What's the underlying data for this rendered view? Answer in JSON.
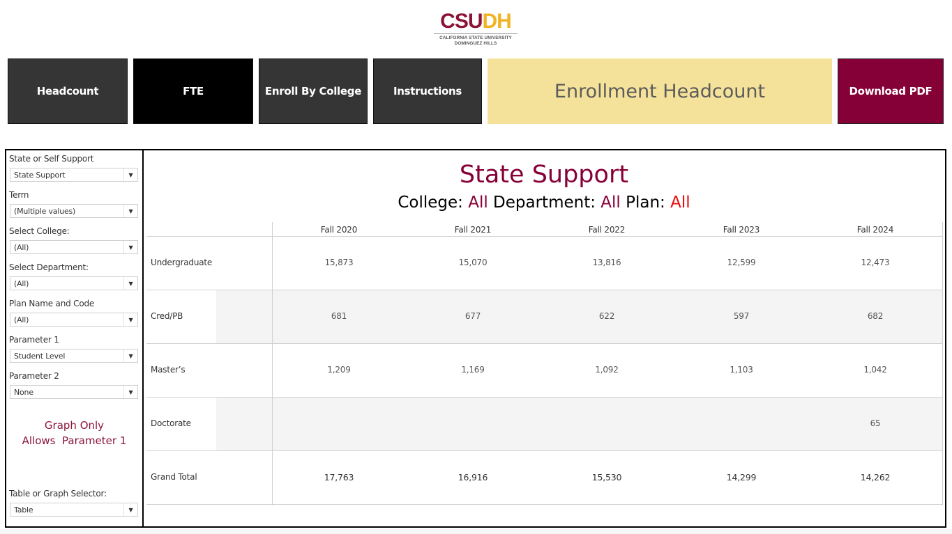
{
  "logo": {
    "word_csu": "CSU",
    "word_dh": "DH",
    "line1": "CALIFORNIA STATE UNIVERSITY",
    "line2": "DOMINGUEZ HILLS"
  },
  "nav": {
    "headcount": "Headcount",
    "fte": "FTE",
    "enroll_by_college": "Enroll By College",
    "instructions": "Instructions",
    "banner": "Enrollment Headcount",
    "download_pdf": "Download PDF"
  },
  "colors": {
    "maroon": "#860038",
    "gold": "#f0b323",
    "banner_bg": "#f5e29a",
    "red": "#e8090c",
    "dark_button": "#353535"
  },
  "filters": [
    {
      "label": "State or Self Support",
      "value": "State Support"
    },
    {
      "label": "Term",
      "value": "(Multiple values)"
    },
    {
      "label": "Select College:",
      "value": "(All)"
    },
    {
      "label": "Select Department:",
      "value": "(All)"
    },
    {
      "label": "Plan Name and Code",
      "value": "(All)"
    },
    {
      "label": "Parameter 1",
      "value": "Student Level"
    },
    {
      "label": "Parameter 2",
      "value": "None"
    }
  ],
  "note": {
    "line1": "Graph Only",
    "line2": "Allows  Parameter 1"
  },
  "view_selector": {
    "label": "Table or Graph Selector:",
    "value": "Table"
  },
  "dropdown_arrow_icon": "▼",
  "main": {
    "title": "State Support",
    "subtitle": {
      "college_label": "College: ",
      "college_value": "All",
      "department_label": " Department: ",
      "department_value": "All",
      "plan_label": " Plan: ",
      "plan_value": "All"
    }
  },
  "table": {
    "columns": [
      "Fall 2020",
      "Fall 2021",
      "Fall 2022",
      "Fall 2023",
      "Fall 2024"
    ],
    "rows": [
      {
        "label": "Undergraduate",
        "values": [
          "15,873",
          "15,070",
          "13,816",
          "12,599",
          "12,473"
        ]
      },
      {
        "label": "Cred/PB",
        "values": [
          "681",
          "677",
          "622",
          "597",
          "682"
        ]
      },
      {
        "label": "Master’s",
        "values": [
          "1,209",
          "1,169",
          "1,092",
          "1,103",
          "1,042"
        ]
      },
      {
        "label": "Doctorate",
        "values": [
          "",
          "",
          "",
          "",
          "65"
        ]
      },
      {
        "label": "Grand Total",
        "values": [
          "17,763",
          "16,916",
          "15,530",
          "14,299",
          "14,262"
        ]
      }
    ]
  }
}
